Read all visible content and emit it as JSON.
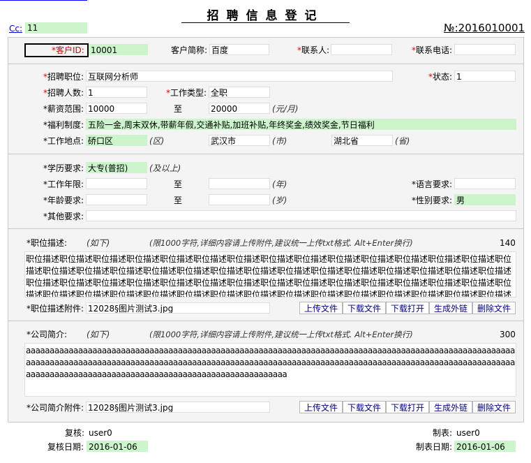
{
  "header": {
    "title": "招聘信息登记",
    "cc_label": "Cc:",
    "cc_value": "11",
    "doc_no": "№:2016010001"
  },
  "row1": {
    "customer_id_label": "客户ID:",
    "customer_id_req": "*",
    "customer_id": "10001",
    "customer_name_label": "客户简称:",
    "customer_name": "百度",
    "contact_req": "*",
    "contact_label": "联系人:",
    "contact": "",
    "phone_req": "*",
    "phone_label": "联系电话:",
    "phone": ""
  },
  "job": {
    "position_req": "*",
    "position_label": "招聘职位:",
    "position": "互联网分析师",
    "status_req": "*",
    "status_label": "状态:",
    "status": "1",
    "count_req": "*",
    "count_label": "招聘人数:",
    "count": "1",
    "worktype_req": "*",
    "worktype_label": "工作类型:",
    "worktype": "全职",
    "salary_label": "*薪资范围:",
    "salary_min": "10000",
    "to": "至",
    "salary_max": "20000",
    "salary_unit": "(元/月)",
    "welfare_label": "*福利制度:",
    "welfare": "五险一金,周末双休,带薪年假,交通补贴,加班补贴,年终奖金,绩效奖金,节日福利",
    "location_label": "*工作地点:",
    "district": "硚口区",
    "district_unit": "(区)",
    "city": "武汉市",
    "city_unit": "(市)",
    "province": "湖北省",
    "province_unit": "(省)"
  },
  "req": {
    "edu_label": "*学历要求:",
    "edu": "大专(普招)",
    "edu_hint": "(及以上)",
    "years_label": "*工作年限:",
    "to": "至",
    "years_unit": "(年)",
    "lang_label": "*语言要求:",
    "lang": "",
    "age_label": "*年龄要求:",
    "age_unit": "(岁)",
    "gender_label": "*性别要求:",
    "gender": "男",
    "other_label": "*其他要求:"
  },
  "jobdesc": {
    "label": "*职位描述:",
    "hint_below": "(如下)",
    "hint": "(限1000字符,详细内容请上传附件,建议统一上传txt格式. Alt+Enter换行)",
    "count": "140",
    "text": "职位描述职位描述职位描述职位描述职位描述职位描述职位描述职位描述职位描述职位描述职位描述职位描述职位描述职位描述职位描述职位描述职位描述职位描述职位描述职位描述职位描述职位描述职位描述职位描述职位描述职位描述职位描述职位描述职位描述职位描述职位描述职位描述职位描述职位描述职位描述职位描述职位描述职位描述职位描述职位描述职位描述职位描述职位描述职位描述职位描述职位描述职位描述职位描述职位描述职位描述职位描述职位描述职位描述职位描述职位描述职位描述职位描述职位描述",
    "attach_label": "*职位描述附件:",
    "attach": "12028§图片测试3.jpg"
  },
  "company": {
    "label": "*公司简介:",
    "hint_below": "(如下)",
    "hint": "(限1000字符,详细内容请上传附件,建议统一上传txt格式. Alt+Enter换行)",
    "count": "300",
    "text": "aaaaaaaaaaaaaaaaaaaaaaaaaaaaaaaaaaaaaaaaaaaaaaaaaaaaaaaaaaaaaaaaaaaaaaaaaaaaaaaaaaaaaaaaaaaaaaaaaaaaaaaaaaaaaaaaaaaaaaaaaaaaaaaaaaaaaaaaaaaaaaaaaaaaaaaaaaaaaaaaaaaaaaaaaaaaaaaaaaaaaaaaaaaaaaaaaaaaaaaaaaaaaaaaaaaaaaaaaaaaaaaaaaaaaaaaaaaaaaaaaaaaaaaaaaaaaaaaaaaaa",
    "attach_label": "*公司简介附件:",
    "attach": "12028§图片测试3.jpg"
  },
  "buttons": {
    "upload": "上传文件",
    "download": "下载文件",
    "open": "下载打开",
    "link": "生成外链",
    "delete": "删除文件"
  },
  "footer": {
    "review_label": "复核:",
    "reviewer": "user0",
    "review_date_label": "复核日期:",
    "review_date": "2016-01-06",
    "maker_label": "制表:",
    "maker": "user0",
    "make_date_label": "制表日期:",
    "make_date": "2016-01-06"
  }
}
